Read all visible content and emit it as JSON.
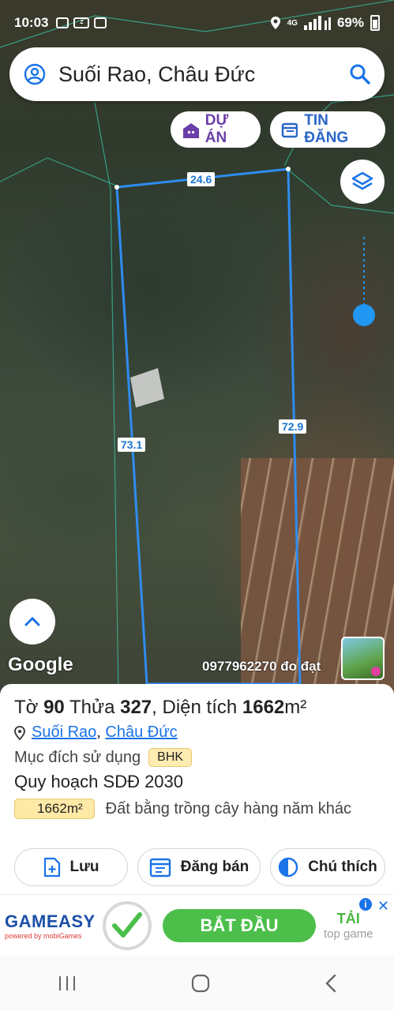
{
  "status_bar": {
    "time": "10:03",
    "network": "4G",
    "battery": "69%",
    "app_icons": [
      "gallery-icon",
      "zalo-icon",
      "app-icon"
    ]
  },
  "search": {
    "value": "Suối Rao, Châu Đức"
  },
  "chips": {
    "du_an": "DỰ ÁN",
    "tin_dang": "TIN ĐĂNG"
  },
  "map": {
    "dimensions": {
      "top": "24.6",
      "left": "73.1",
      "right": "72.9"
    },
    "google": "Google",
    "phone_label": "0977962270 đo đạt",
    "line_color": "#2f8cf0"
  },
  "parcel": {
    "title_prefix": "Tờ",
    "to_no": "90",
    "thua_label": "Thửa",
    "thua_no": "327",
    "area_label": ", Diện tích",
    "area": "1662",
    "area_unit": "m²",
    "loc_commune": "Suối Rao",
    "loc_separator": ",",
    "loc_district": "Châu Đức",
    "purpose_label": "Mục đích sử dụng",
    "purpose_code": "BHK",
    "plan_label": "Quy hoạch SDĐ 2030",
    "plan_area": "1662m²",
    "plan_desc": "Đất bằng trồng cây hàng năm khác"
  },
  "actions": {
    "save": "Lưu",
    "sell": "Đăng bán",
    "legend": "Chú thích"
  },
  "ad": {
    "brand": "GAMEASY",
    "brand_sub": "powered by mobiGames",
    "cta": "BẮT ĐẦU",
    "side_top": "TẢI",
    "side_bottom": "top game"
  }
}
